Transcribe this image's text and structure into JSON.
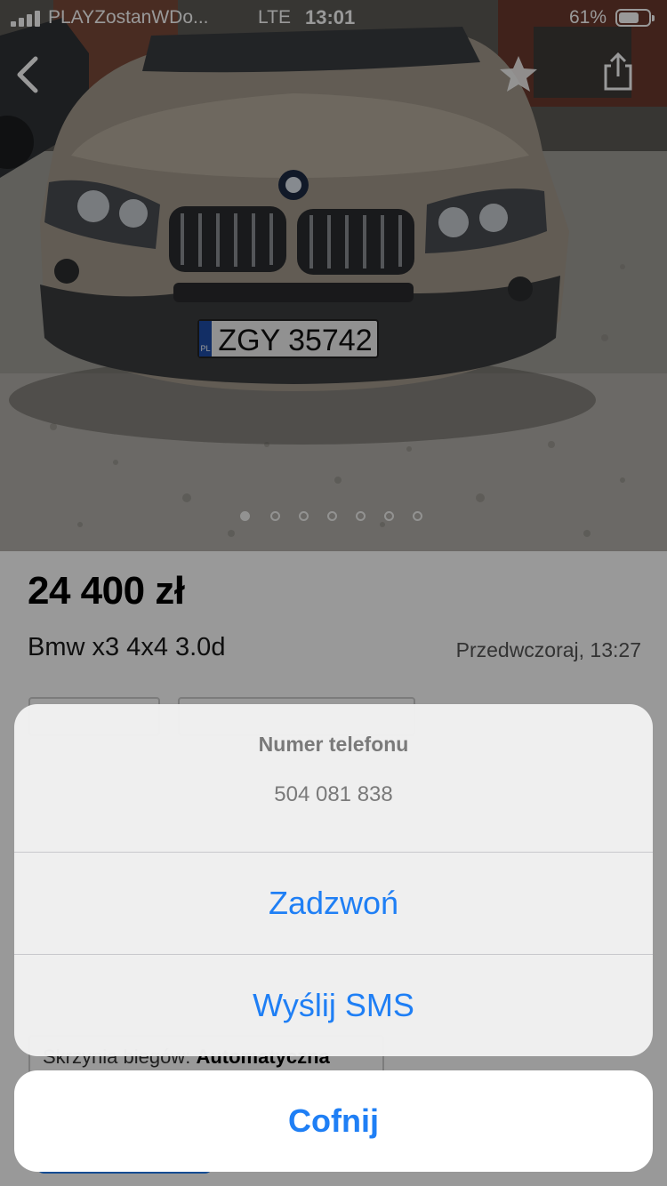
{
  "status_bar": {
    "carrier": "PLAYZostanWDo...",
    "network": "LTE",
    "time": "13:01",
    "battery_percent": "61%"
  },
  "nav": {
    "back_icon": "chevron-left-icon",
    "favorite_icon": "star-icon",
    "share_icon": "share-icon"
  },
  "photo": {
    "plate_text": "ZGY 35742",
    "plate_country": "PL",
    "gallery_count": 7,
    "gallery_active_index": 0
  },
  "listing": {
    "price": "24 400 zł",
    "title": "Bmw x3 4x4 3.0d",
    "date": "Przedwczoraj, 13:27",
    "params": [
      {
        "label": "",
        "value": ""
      },
      {
        "label": "",
        "value": ""
      },
      {
        "label": "Skrzynia biegów:",
        "value": "Automatyczna"
      }
    ]
  },
  "action_sheet": {
    "title": "Numer telefonu",
    "message": "504 081 838",
    "actions": [
      "Zadzwoń",
      "Wyślij SMS"
    ],
    "cancel": "Cofnij"
  },
  "colors": {
    "accent": "#1f7ff5",
    "overlay": "rgba(0,0,0,0.40)"
  }
}
